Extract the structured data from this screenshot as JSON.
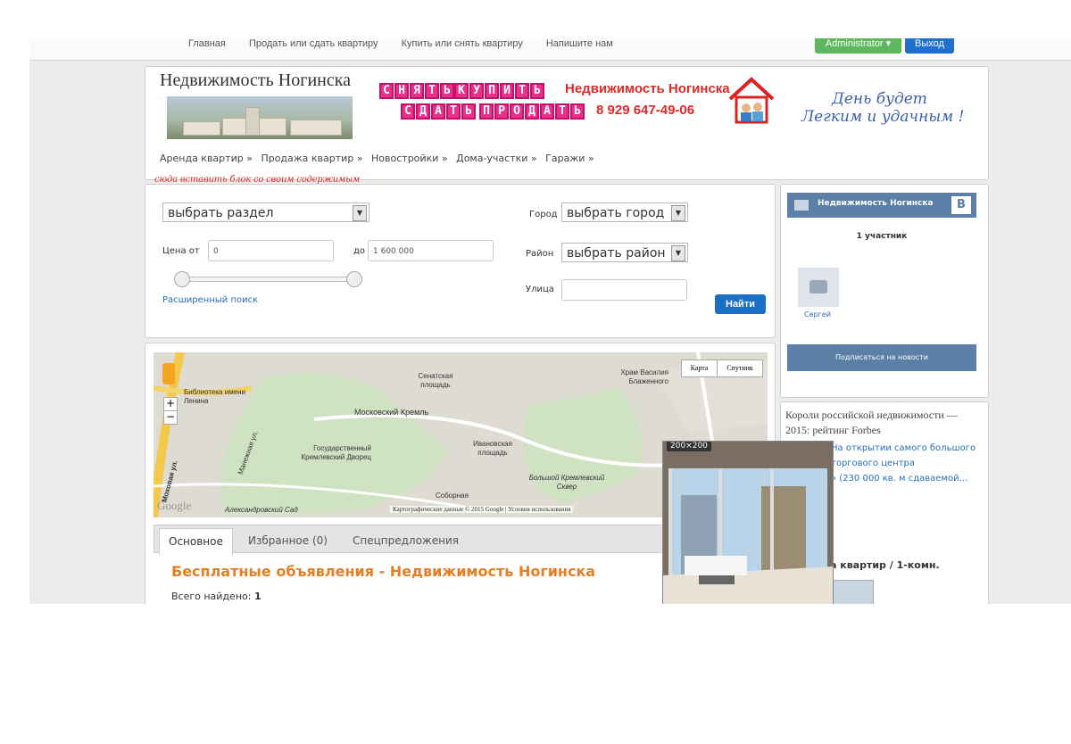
{
  "topbar": {
    "nav": [
      "Главная",
      "Продать или сдать квартиру",
      "Купить или снять квартиру",
      "Напишите нам"
    ],
    "admin_label": "Administrator",
    "exit_label": "Выход"
  },
  "header": {
    "site_title": "Недвижимость Ногинска",
    "stamp_row1a": [
      "С",
      "Н",
      "Я",
      "Т",
      "Ь"
    ],
    "stamp_row1b": [
      "К",
      "У",
      "П",
      "И",
      "Т",
      "Ь"
    ],
    "stamp_row2a": [
      "С",
      "Д",
      "А",
      "Т",
      "Ь"
    ],
    "stamp_row2b": [
      "П",
      "Р",
      "О",
      "Д",
      "А",
      "Т",
      "Ь"
    ],
    "brand_name": "Недвижимость Ногинска",
    "phone": "8 929 647-49-06",
    "slogan_line1": "День будет",
    "slogan_line2": "Легким и удачным !",
    "menu": [
      "Аренда квартир »",
      "Продажа квартир »",
      "Новостройки »",
      "Дома-участки »",
      "Гаражи »"
    ]
  },
  "annotation": "сюда вставить блок со своим содержимым",
  "search": {
    "section_select": "выбрать раздел",
    "price_from_label": "Цена от",
    "price_from_value": "0",
    "price_to_label": "до",
    "price_to_value": "1 600 000",
    "advanced_link": "Расширенный поиск",
    "city_label": "Город",
    "city_select": "выбрать город",
    "district_label": "Район",
    "district_select": "выбрать район",
    "street_label": "Улица",
    "find_button": "Найти"
  },
  "map": {
    "type_map": "Карта",
    "type_satellite": "Спутник",
    "labels": {
      "library": "Библиотека имени Ленина",
      "senate": "Сенатская площадь",
      "basil": "Храм Василия Блаженного",
      "kremlin": "Московский Кремль",
      "palace": "Государственный Кремлевский Дворец",
      "ivanov": "Ивановская площадь",
      "manege": "Манежная ул.",
      "sobor": "Соборная",
      "square": "Большой Кремлевский Сквер",
      "garden": "Александровский Сад",
      "mokh": "Моховая ул.",
      "google": "Google",
      "copyright": "Картографические данные © 2015 Google",
      "terms": "Условия использования"
    }
  },
  "thumb_badge": "200×200",
  "tabs": [
    "Основное",
    "Избранное (0)",
    "Спецпредложения"
  ],
  "main": {
    "title": "Бесплатные объявления - Недвижимость Ногинска",
    "found_label": "Всего найдено:",
    "found_count": "1"
  },
  "vk": {
    "group": "Недвижимость Ногинска",
    "members": "1 участник",
    "user": "Сергей",
    "subscribe": "Подписаться на новости",
    "logo_letter": "B"
  },
  "news": {
    "title": "Короли российской недвижимости — 2015: рейтинг Forbes",
    "line1": "На открытии самого большого",
    "line2": "торгового центра",
    "line3": "» (230 000 кв. м сдаваемой…",
    "listing": "а квартир / 1-комн."
  }
}
